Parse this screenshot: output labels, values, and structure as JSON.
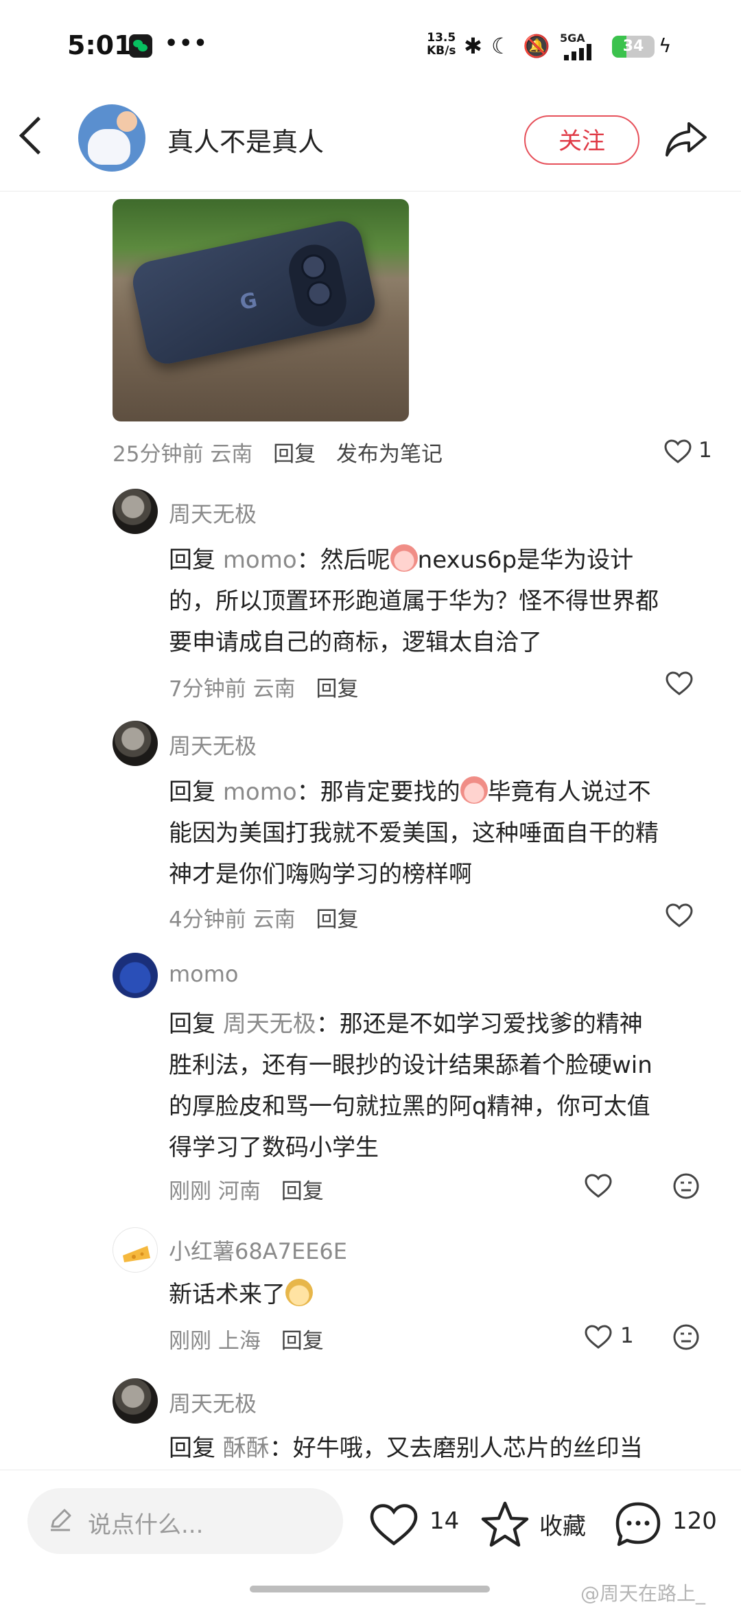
{
  "status_bar": {
    "time": "5:01",
    "dots": "•••",
    "net_speed_value": "13.5",
    "net_speed_unit": "KB/s",
    "network": "5GA",
    "battery": "34"
  },
  "header": {
    "title": "真人不是真人",
    "follow_label": "关注"
  },
  "post": {
    "meta_time": "25分钟前",
    "meta_location": "云南",
    "reply_label": "回复",
    "publish_note_label": "发布为笔记",
    "like_count": "1"
  },
  "comments": [
    {
      "name": "周天无极",
      "lines": [
        "回复",
        "momo",
        "：然后呢",
        "nexus6p是华为设计",
        "的，所以顶置环形跑道属于华为？怪不得世界都",
        "要申请成自己的商标，逻辑太自洽了"
      ],
      "time": "7分钟前",
      "location": "云南",
      "reply_label": "回复"
    },
    {
      "name": "周天无极",
      "lines": [
        "回复",
        "momo",
        "：那肯定要找的",
        "毕竟有人说过不",
        "能因为美国打我就不爱美国，这种唾面自干的精",
        "神才是你们嗨购学习的榜样啊"
      ],
      "time": "4分钟前",
      "location": "云南",
      "reply_label": "回复"
    },
    {
      "name": "momo",
      "lines": [
        "回复",
        "周天无极",
        "：那还是不如学习爱找爹的精神",
        "胜利法，还有一眼抄的设计结果舔着个脸硬win",
        "的厚脸皮和骂一句就拉黑的阿q精神，你可太值",
        "得学习了数码小学生"
      ],
      "time": "刚刚",
      "location": "河南",
      "reply_label": "回复"
    },
    {
      "name": "小红薯68A7EE6E",
      "lines": [
        "新话术来了"
      ],
      "time": "刚刚",
      "location": "上海",
      "reply_label": "回复",
      "like_count": "1"
    },
    {
      "name": "周天无极",
      "lines": [
        "回复",
        "酥酥",
        "：好牛哦，又去磨别人芯片的丝印当"
      ]
    }
  ],
  "bottom_bar": {
    "input_placeholder": "说点什么...",
    "like_count": "14",
    "collect_label": "收藏",
    "comment_count": "120"
  },
  "watermark": "@周天在路上_"
}
